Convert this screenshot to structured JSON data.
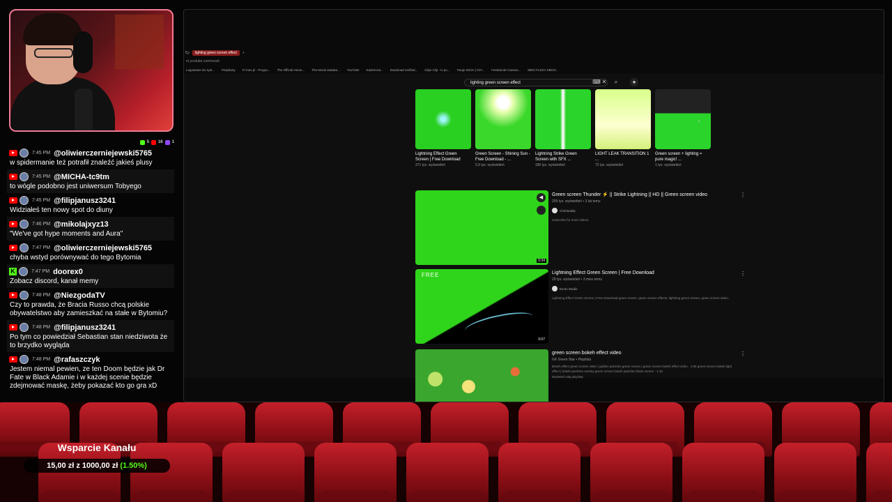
{
  "chat": {
    "topbar": {
      "count_a": "5",
      "count_b": "16",
      "count_c": "1"
    },
    "messages": [
      {
        "platform": "youtube",
        "time": "7:45 PM",
        "user": "@oliwierczerniejewski5765",
        "text": "w spidermanie też potrafił znaleźć jakieś plusy"
      },
      {
        "platform": "youtube",
        "time": "7:45 PM",
        "user": "@MICHA-tc9tm",
        "text": "to wógle podobno jest uniwersum Tobyego"
      },
      {
        "platform": "youtube",
        "time": "7:45 PM",
        "user": "@filipjanusz3241",
        "text": "Widziałeś ten nowy spot do diuny"
      },
      {
        "platform": "youtube",
        "time": "7:46 PM",
        "user": "@mikolajxyz13",
        "text": "\"We've got hype moments and Aura\""
      },
      {
        "platform": "youtube",
        "time": "7:47 PM",
        "user": "@oliwierczerniejewski5765",
        "text": "chyba wstyd porównywać do tego Bytomia"
      },
      {
        "platform": "kick",
        "time": "7:47 PM",
        "user": "doorex0",
        "text": "Zobacz discord, kanał memy"
      },
      {
        "platform": "youtube",
        "time": "7:48 PM",
        "user": "@NiezgodaTV",
        "text": "Czy to prawda, że Bracia Russo chcą polskie obywatelstwo aby zamieszkać na stałe w Bytomiu?"
      },
      {
        "platform": "youtube",
        "time": "7:48 PM",
        "user": "@filipjanusz3241",
        "text": "Po tym co powiedział Sebastian stan niedziwota że to brzydko wygląda"
      },
      {
        "platform": "youtube",
        "time": "7:48 PM",
        "user": "@rafaszczyk",
        "text": "Jestem niemal pewien, ze ten Doom będzie jak Dr Fate w Black Adamie i w każdej scenie będzie zdejmować maskę, żeby pokazać kto go gra xD"
      }
    ]
  },
  "browser": {
    "active_tab": "lighting green screen effect",
    "address": "m.youtube.com/result",
    "bookmarks": [
      "Logowanie do syst...",
      "Perplexity",
      "Fi-mes.pl - Progra...",
      "The Official Home...",
      "The Movie Databa...",
      "YouTube",
      "Kadzenrat...",
      "Download verified...",
      "Clips Clip - K-po...",
      "Twoje eDOA | IOY...",
      "Festival de Cannes...",
      "MIECYCZKA SMOC..."
    ],
    "search_query": "lighting green screen effect",
    "shorts": [
      {
        "title": "Lightning Effect Green Screen | Free Download",
        "views": "371 tys. wyświetleń"
      },
      {
        "title": "Green Screen - Shining Sun - Free Download - ...",
        "views": "5,9 tys. wyświetleń"
      },
      {
        "title": "Lightning Strike Green Screen with SFX ...",
        "views": "180 tys. wyświetleń"
      },
      {
        "title": "LIGHT LEAK TRANSITION 1 ...",
        "views": "72 tys. wyświetleń"
      },
      {
        "title": "Green screen + lighting = pure magic! ...",
        "views": "1 tys. wyświetleń"
      }
    ],
    "videos": [
      {
        "title": "Green screen Thunder ⚡ || Strike Lightning || HD || Green screen video",
        "meta": "259 tys. wyświetleń • 3 lat temu",
        "channel": "Chili Buddy",
        "desc": "Subscribe for more videos.",
        "duration": "0:34"
      },
      {
        "title": "Lightning Effect Green Screen | Free Download",
        "meta": "29 tys. wyświetleń • 3 mies temu",
        "channel": "Exoto Studio",
        "desc": "Lightning Effect Green Screen | Free Download green screen, green screen effects, lightning green screen, green screen video,",
        "duration": "0:07",
        "badge": "FREE"
      },
      {
        "title": "green screen bokeh effect video",
        "meta": "GK Green Star • Playlista",
        "channel": "",
        "desc": "Bokeh effect green screen video | golden particles green screen | green screen bokeh effect video · 1:05 green screen bokeh light effect | bokeh particles overlay green screen bokeh particles black screen · 1:18",
        "more": "Wyświetl całą playlistę",
        "duration": ""
      }
    ]
  },
  "support": {
    "heading": "Wsparcie Kanału",
    "amount": "15,00 zł",
    "sep": "z",
    "goal": "1000,00 zł",
    "percent": "(1.50%)"
  },
  "colors": {
    "accent": "#53fc18",
    "youtube": "#ff0000",
    "kick": "#53fc18",
    "seat": "#b8141e",
    "cam_border": "#f07a95"
  }
}
